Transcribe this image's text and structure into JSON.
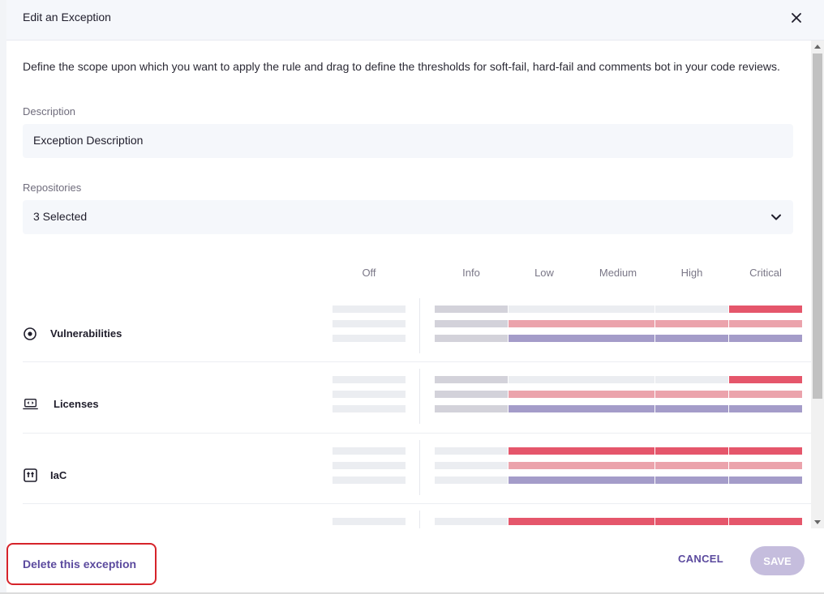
{
  "header": {
    "title": "Edit an Exception"
  },
  "intro": "Define the scope upon which you want to apply the rule and drag to define the thresholds for soft-fail, hard-fail and comments bot in your code reviews.",
  "description": {
    "label": "Description",
    "value": "Exception Description"
  },
  "repositories": {
    "label": "Repositories",
    "value": "3 Selected"
  },
  "columns": [
    "Off",
    "Info",
    "Low",
    "Medium",
    "High",
    "Critical"
  ],
  "rows": [
    {
      "label": "Vulnerabilities",
      "icon": "target-icon"
    },
    {
      "label": "Licenses",
      "icon": "laptop-code-icon"
    },
    {
      "label": "IaC",
      "icon": "iac-icon"
    }
  ],
  "colors": {
    "gray": "#ebedf1",
    "gray_dark": "#d3d2da",
    "red": "#e5566b",
    "pink": "#eba3ac",
    "purple": "#a49cc9",
    "accent": "#5b4a9e"
  },
  "footer": {
    "delete": "Delete this exception",
    "cancel": "CANCEL",
    "save": "SAVE"
  }
}
